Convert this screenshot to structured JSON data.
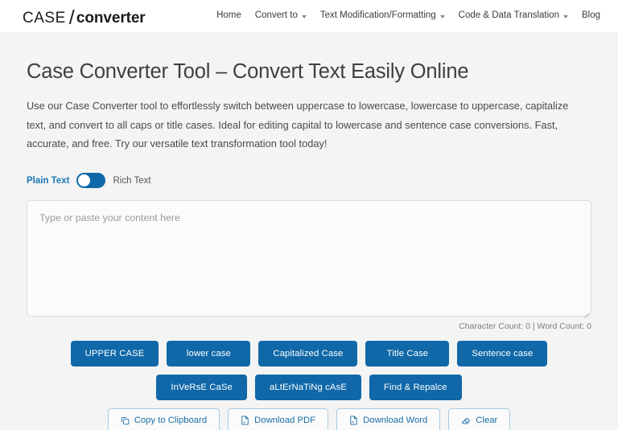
{
  "header": {
    "logo": {
      "part1": "CASE",
      "separator": "/",
      "part2": "converter"
    },
    "nav": [
      {
        "label": "Home",
        "has_dropdown": false
      },
      {
        "label": "Convert to",
        "has_dropdown": true
      },
      {
        "label": "Text Modification/Formatting",
        "has_dropdown": true
      },
      {
        "label": "Code & Data Translation",
        "has_dropdown": true
      },
      {
        "label": "Blog",
        "has_dropdown": false
      }
    ]
  },
  "main": {
    "title": "Case Converter Tool – Convert Text Easily Online",
    "description": "Use our Case Converter tool to effortlessly switch between uppercase to lowercase, lowercase to uppercase, capitalize text, and convert to all caps or title cases. Ideal for editing capital to lowercase and sentence case conversions. Fast, accurate, and free. Try our versatile text transformation tool today!",
    "toggle": {
      "left_label": "Plain Text",
      "right_label": "Rich Text",
      "state": "plain"
    },
    "editor": {
      "placeholder": "Type or paste your content here",
      "value": ""
    },
    "counter": "Character Count: 0 | Word Count: 0",
    "case_buttons_row1": [
      "UPPER CASE",
      "lower case",
      "Capitalized Case",
      "Title Case",
      "Sentence case"
    ],
    "case_buttons_row2": [
      "InVeRsE CaSe",
      "aLtErNaTiNg cAsE",
      "Find & Repalce"
    ],
    "action_buttons": [
      {
        "label": "Copy to Clipboard",
        "icon": "copy-icon"
      },
      {
        "label": "Download PDF",
        "icon": "pdf-file-icon"
      },
      {
        "label": "Download Word",
        "icon": "word-file-icon"
      },
      {
        "label": "Clear",
        "icon": "eraser-icon"
      }
    ]
  },
  "colors": {
    "primary": "#1068a8",
    "outline_text": "#1a6ea8",
    "outline_border": "#a8cde4",
    "page_bg": "#f4f4f4",
    "header_bg": "#ffffff"
  }
}
